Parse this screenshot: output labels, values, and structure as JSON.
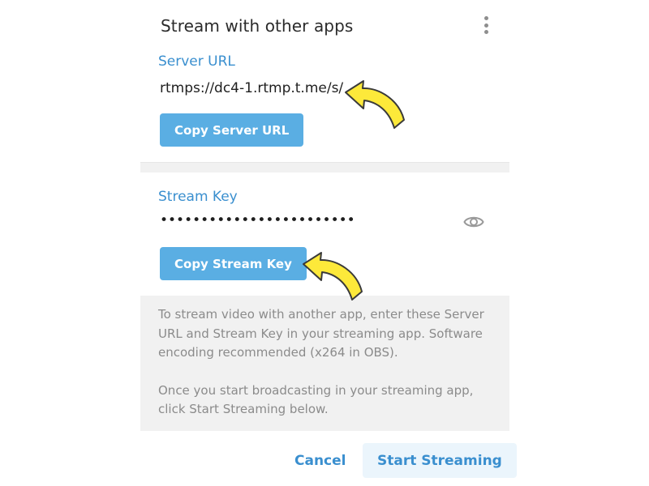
{
  "dialog": {
    "title": "Stream with other apps",
    "menu_icon": "vertical-ellipsis-icon"
  },
  "server": {
    "label": "Server URL",
    "value": "rtmps://dc4-1.rtmp.t.me/s/",
    "copy_label": "Copy Server URL"
  },
  "stream_key": {
    "label": "Stream Key",
    "masked_value": "••••••••••••••••••••••••",
    "reveal_icon": "eye-icon",
    "copy_label": "Copy Stream Key"
  },
  "info": {
    "paragraph_1": "To stream video with another app, enter these Server URL and Stream Key in your streaming app. Software encoding recommended (x264 in OBS).",
    "paragraph_2": "Once you start broadcasting in your streaming app, click Start Streaming below."
  },
  "footer": {
    "cancel_label": "Cancel",
    "start_label": "Start Streaming"
  },
  "annotations": {
    "arrow_icon": "yellow-pointer-arrow-icon"
  },
  "colors": {
    "accent": "#3a8fcf",
    "button_bg": "#5aaee3",
    "panel_bg": "#f1f1f1",
    "muted_text": "#8b8b8b",
    "arrow": "#fde93a"
  }
}
